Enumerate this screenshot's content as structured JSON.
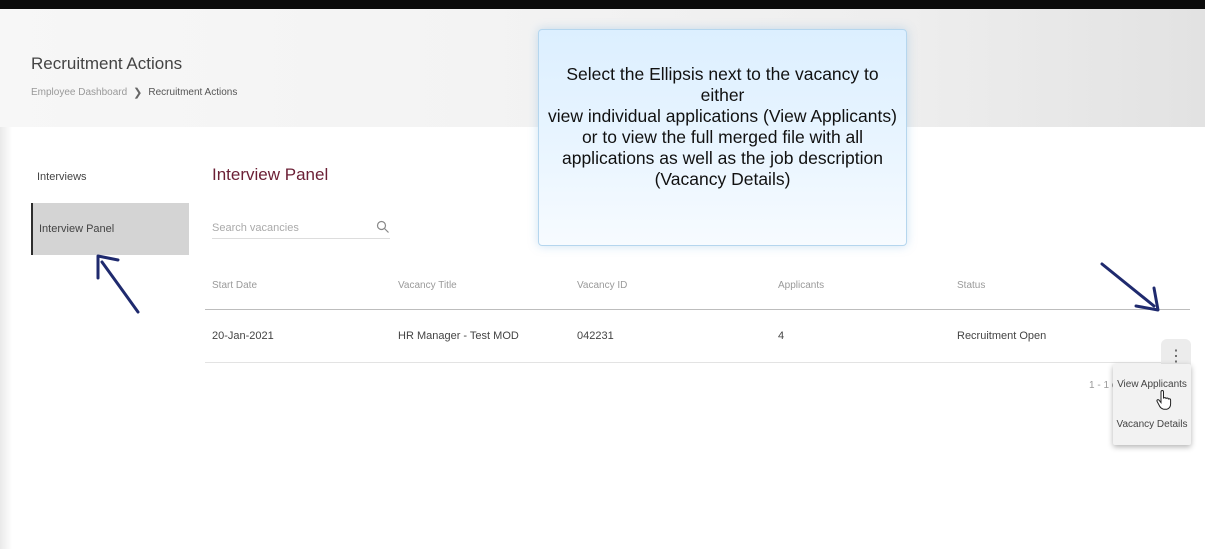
{
  "header": {
    "title": "Recruitment Actions",
    "breadcrumb": {
      "home": "Employee Dashboard",
      "separator": "❯",
      "current": "Recruitment Actions"
    }
  },
  "sidebar": {
    "items": [
      {
        "label": "Interviews",
        "active": false
      },
      {
        "label": "Interview Panel",
        "active": true
      }
    ]
  },
  "panel": {
    "title": "Interview Panel",
    "search": {
      "placeholder": "Search vacancies",
      "value": "",
      "icon": "search-icon"
    }
  },
  "table": {
    "columns": [
      "Start Date",
      "Vacancy Title",
      "Vacancy ID",
      "Applicants",
      "Status"
    ],
    "rows": [
      {
        "start_date": "20-Jan-2021",
        "vacancy_title": "HR Manager - Test MOD",
        "vacancy_id": "042231",
        "applicants": "4",
        "status": "Recruitment Open"
      }
    ],
    "row_actions_icon": "⋮",
    "paginator": "1 - 1 o"
  },
  "context_menu": {
    "items": [
      "View Applicants",
      "Vacancy Details"
    ]
  },
  "callout": {
    "lines": [
      "Select the Ellipsis next to the vacancy to either",
      "view individual applications (View Applicants)",
      "or to view the full merged file with all",
      "applications as well as the job description",
      "(Vacancy Details)"
    ]
  },
  "colors": {
    "accent_title": "#6b1f35",
    "annotation_arrow": "#1f2a6e",
    "callout_bg": "#e3f1fd"
  }
}
